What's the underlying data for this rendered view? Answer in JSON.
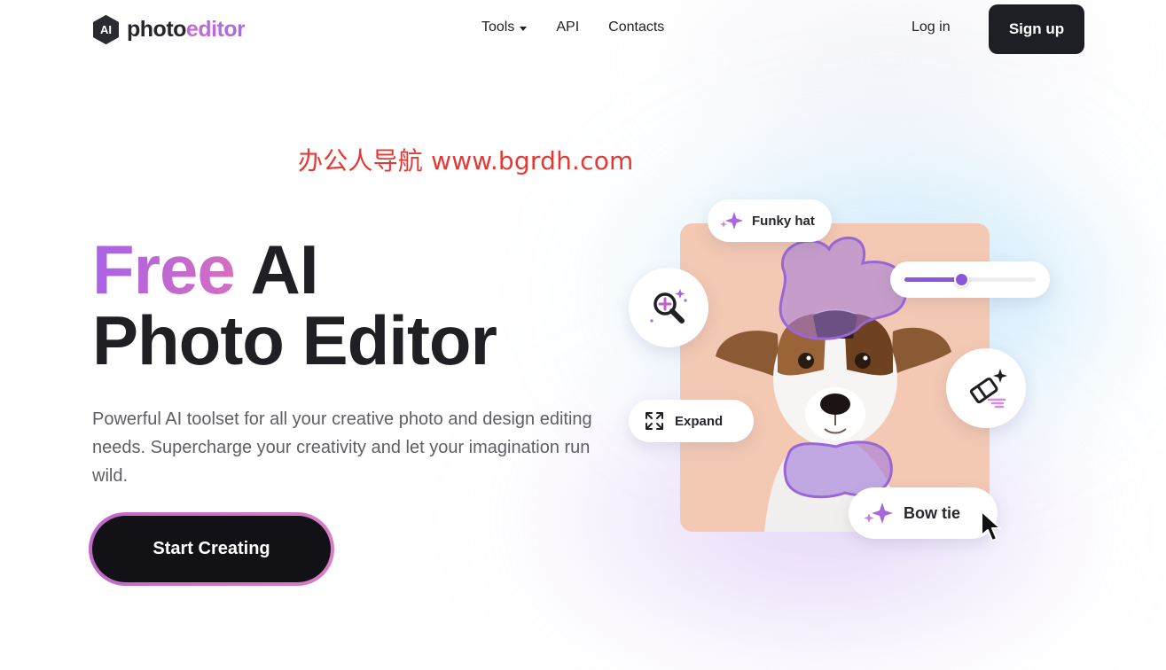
{
  "header": {
    "logo_badge": "AI",
    "logo_prefix": "photo",
    "logo_accent": "editor",
    "nav": [
      {
        "label": "Tools",
        "has_dropdown": true
      },
      {
        "label": "API"
      },
      {
        "label": "Contacts"
      }
    ],
    "login_label": "Log in",
    "signup_label": "Sign up"
  },
  "watermark": "办公人导航 www.bgrdh.com",
  "hero": {
    "title_free": "Free",
    "title_ai": " AI",
    "title_line2": "Photo Editor",
    "description": "Powerful AI toolset for all your creative photo and design editing needs. Supercharge your creativity and let your imagination run wild.",
    "cta_label": "Start Creating"
  },
  "illustration": {
    "chip_funky_hat": "Funky hat",
    "chip_expand": "Expand",
    "chip_bow_tie": "Bow tie",
    "slider_level": 0.43,
    "icons": [
      "sparkle-icon",
      "zoom-plus-icon",
      "expand-icon",
      "eraser-icon",
      "cursor-icon"
    ]
  },
  "colors": {
    "primary_dark": "#1e1f25",
    "accent_purple": "#8d55d8",
    "accent_pink": "#d56ec0",
    "photo_background": "#f4c9b3",
    "watermark_red": "#e53935"
  }
}
